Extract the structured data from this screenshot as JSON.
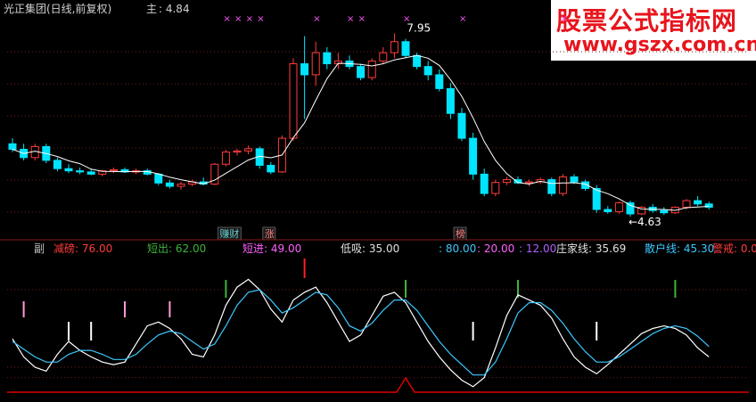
{
  "header": {
    "stock_title": "光正集团(日线,前复权)",
    "main_label": "主",
    "main_value": ": 4.84"
  },
  "watermark": {
    "title": "股票公式指标网",
    "url": "www.gszx.com.cn"
  },
  "price_annotations": {
    "high": "7.95",
    "low": "←4.63"
  },
  "events": [
    {
      "label": "赚财",
      "color": "#66cccc"
    },
    {
      "label": "涨",
      "color": "#ff8080"
    },
    {
      "label": "榜",
      "color": "#ff8080"
    }
  ],
  "sub_legend": [
    {
      "label": "副",
      "color": "#c0c0c0"
    },
    {
      "label": "减磅: 76.00",
      "color": "#ff3c3c"
    },
    {
      "label": "短出: 62.00",
      "color": "#3cb43c"
    },
    {
      "label": "短进: 49.00",
      "color": "#ff60ff"
    },
    {
      "label": "低吸: 35.00",
      "color": "#e0e0e0"
    },
    {
      "label": ": 80.00",
      "color": "#3cc8ff"
    },
    {
      "label": ": 20.00",
      "color": "#ff60ff"
    },
    {
      "label": ": 12.00",
      "color": "#b060ff"
    },
    {
      "label": "庄家线: 35.69",
      "color": "#e0e0e0"
    },
    {
      "label": "散户线: 45.30",
      "color": "#3cc8ff"
    },
    {
      "label": "警戒: 0.00",
      "color": "#ff3c3c"
    }
  ],
  "colors": {
    "up": "#ff3c3c",
    "down": "#00e5ff",
    "white_line": "#ffffff",
    "cyan_line": "#3cc8ff",
    "alert": "#dd0000",
    "star": "#ff55ff",
    "grid": "#7a1a1a"
  },
  "chart_data": [
    {
      "type": "candlestick",
      "price_range": [
        4.55,
        8.2
      ],
      "star_markers_at_bar": [
        19,
        20,
        21,
        22,
        27,
        30,
        31,
        35,
        40,
        49
      ],
      "event_markers_at_bar": [
        19,
        23,
        40
      ],
      "high_marker_bar": 34,
      "low_marker_bar": 55,
      "bars": [
        [
          5.95,
          6.05,
          5.8,
          5.85
        ],
        [
          5.85,
          5.95,
          5.65,
          5.7
        ],
        [
          5.7,
          5.95,
          5.65,
          5.9
        ],
        [
          5.9,
          5.95,
          5.6,
          5.65
        ],
        [
          5.65,
          5.7,
          5.45,
          5.5
        ],
        [
          5.5,
          5.58,
          5.42,
          5.46
        ],
        [
          5.46,
          5.52,
          5.4,
          5.44
        ],
        [
          5.44,
          5.5,
          5.38,
          5.4
        ],
        [
          5.4,
          5.48,
          5.36,
          5.46
        ],
        [
          5.46,
          5.52,
          5.42,
          5.48
        ],
        [
          5.48,
          5.52,
          5.42,
          5.44
        ],
        [
          5.44,
          5.5,
          5.4,
          5.46
        ],
        [
          5.46,
          5.5,
          5.38,
          5.4
        ],
        [
          5.4,
          5.42,
          5.2,
          5.24
        ],
        [
          5.24,
          5.3,
          5.14,
          5.18
        ],
        [
          5.18,
          5.26,
          5.12,
          5.22
        ],
        [
          5.22,
          5.3,
          5.18,
          5.26
        ],
        [
          5.26,
          5.34,
          5.2,
          5.22
        ],
        [
          5.22,
          5.6,
          5.2,
          5.58
        ],
        [
          5.58,
          5.84,
          5.54,
          5.8
        ],
        [
          5.8,
          5.86,
          5.74,
          5.82
        ],
        [
          5.82,
          5.92,
          5.76,
          5.86
        ],
        [
          5.86,
          5.9,
          5.5,
          5.56
        ],
        [
          5.56,
          5.62,
          5.4,
          5.44
        ],
        [
          5.44,
          6.1,
          5.42,
          6.05
        ],
        [
          6.05,
          7.5,
          6.0,
          7.4
        ],
        [
          7.4,
          7.9,
          6.4,
          7.2
        ],
        [
          7.2,
          7.8,
          7.0,
          7.6
        ],
        [
          7.6,
          7.7,
          7.3,
          7.4
        ],
        [
          7.4,
          7.6,
          7.3,
          7.45
        ],
        [
          7.45,
          7.55,
          7.3,
          7.35
        ],
        [
          7.35,
          7.4,
          7.1,
          7.15
        ],
        [
          7.15,
          7.5,
          7.1,
          7.45
        ],
        [
          7.45,
          7.7,
          7.4,
          7.6
        ],
        [
          7.6,
          7.95,
          7.5,
          7.8
        ],
        [
          7.8,
          7.85,
          7.5,
          7.55
        ],
        [
          7.55,
          7.6,
          7.3,
          7.35
        ],
        [
          7.35,
          7.45,
          7.1,
          7.2
        ],
        [
          7.2,
          7.3,
          6.9,
          6.95
        ],
        [
          6.95,
          7.05,
          6.4,
          6.5
        ],
        [
          6.5,
          6.6,
          6.0,
          6.05
        ],
        [
          6.05,
          6.15,
          5.3,
          5.4
        ],
        [
          5.4,
          5.5,
          5.0,
          5.05
        ],
        [
          5.05,
          5.3,
          5.0,
          5.25
        ],
        [
          5.25,
          5.35,
          5.2,
          5.3
        ],
        [
          5.3,
          5.36,
          5.22,
          5.24
        ],
        [
          5.24,
          5.3,
          5.18,
          5.26
        ],
        [
          5.26,
          5.34,
          5.22,
          5.3
        ],
        [
          5.3,
          5.34,
          5.0,
          5.05
        ],
        [
          5.05,
          5.4,
          5.0,
          5.35
        ],
        [
          5.35,
          5.4,
          5.22,
          5.26
        ],
        [
          5.26,
          5.3,
          5.1,
          5.14
        ],
        [
          5.14,
          5.2,
          4.7,
          4.76
        ],
        [
          4.76,
          4.82,
          4.68,
          4.72
        ],
        [
          4.72,
          4.9,
          4.68,
          4.88
        ],
        [
          4.88,
          4.92,
          4.63,
          4.68
        ],
        [
          4.68,
          4.82,
          4.66,
          4.8
        ],
        [
          4.8,
          4.86,
          4.7,
          4.74
        ],
        [
          4.74,
          4.8,
          4.66,
          4.7
        ],
        [
          4.7,
          4.82,
          4.68,
          4.8
        ],
        [
          4.8,
          4.95,
          4.76,
          4.92
        ],
        [
          4.92,
          5.0,
          4.82,
          4.86
        ],
        [
          4.86,
          4.9,
          4.76,
          4.8
        ]
      ]
    },
    {
      "type": "line",
      "ylim": [
        0,
        100
      ],
      "reference_levels": [
        80,
        20,
        12
      ],
      "series": [
        {
          "name": "庄家线",
          "color": "#ffffff",
          "values": [
            42,
            28,
            20,
            17,
            30,
            40,
            33,
            28,
            24,
            22,
            24,
            38,
            52,
            55,
            50,
            42,
            30,
            28,
            45,
            68,
            82,
            88,
            80,
            65,
            55,
            72,
            78,
            82,
            70,
            55,
            40,
            45,
            60,
            75,
            78,
            70,
            55,
            40,
            28,
            18,
            10,
            5,
            12,
            35,
            60,
            76,
            72,
            68,
            58,
            42,
            28,
            20,
            15,
            22,
            30,
            38,
            46,
            50,
            52,
            50,
            45,
            35,
            28
          ]
        },
        {
          "name": "散户线",
          "color": "#3cc8ff",
          "values": [
            40,
            34,
            28,
            24,
            24,
            30,
            33,
            33,
            30,
            26,
            26,
            30,
            38,
            45,
            48,
            46,
            40,
            34,
            38,
            52,
            68,
            78,
            80,
            72,
            62,
            66,
            72,
            78,
            76,
            66,
            52,
            48,
            54,
            64,
            72,
            72,
            64,
            52,
            40,
            30,
            22,
            14,
            14,
            24,
            42,
            62,
            70,
            70,
            64,
            54,
            42,
            32,
            24,
            24,
            28,
            34,
            40,
            46,
            50,
            52,
            50,
            44,
            36
          ]
        }
      ],
      "green_signal_bars": [
        19,
        35,
        45,
        59
      ],
      "pink_signal_bars": [
        1,
        10,
        14
      ],
      "white_signal_bars": [
        5,
        7,
        41,
        52
      ],
      "red_signal_bars": [
        26
      ],
      "alert_spike_bar": 35
    }
  ]
}
